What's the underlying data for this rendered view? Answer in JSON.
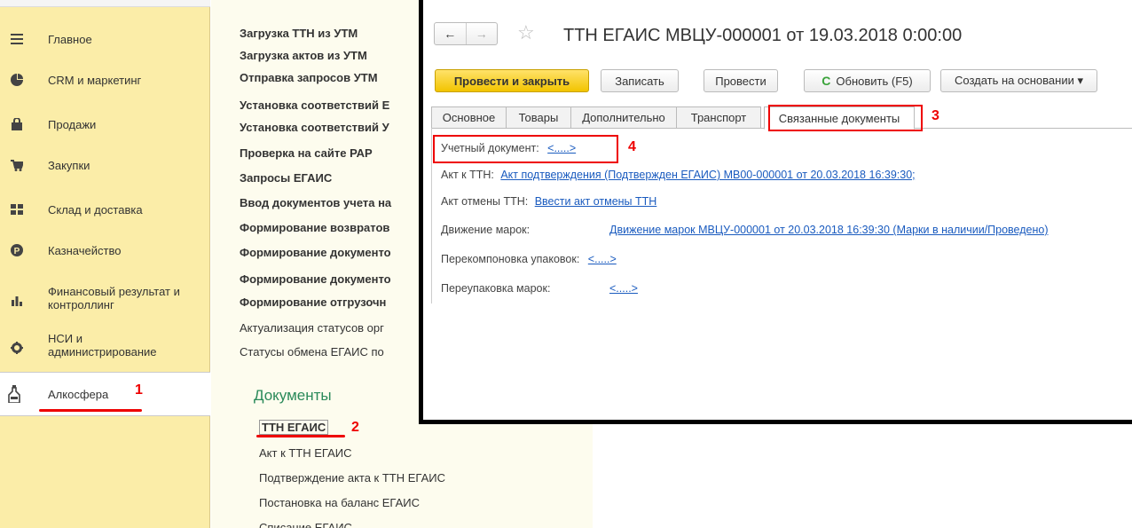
{
  "sidebar": {
    "items": [
      {
        "icon": "menu-icon",
        "label": "Главное"
      },
      {
        "icon": "pie-chart-icon",
        "label": "CRM и маркетинг"
      },
      {
        "icon": "bag-icon",
        "label": "Продажи"
      },
      {
        "icon": "cart-icon",
        "label": "Закупки"
      },
      {
        "icon": "warehouse-icon",
        "label": "Склад и доставка"
      },
      {
        "icon": "coin-icon",
        "label": "Казначейство"
      },
      {
        "icon": "bar-chart-icon",
        "label": "Финансовый результат и",
        "label2": "контроллинг"
      },
      {
        "icon": "gear-icon",
        "label": "НСИ и",
        "label2": "администрирование"
      },
      {
        "icon": "bottle-icon",
        "label": "Алкосфера"
      }
    ]
  },
  "middle": {
    "links": [
      "Загрузка ТТН из УТМ",
      "Загрузка актов из УТМ",
      "Отправка запросов УТМ",
      "Установка соответствий Е",
      "Установка соответствий У",
      "Проверка на сайте РАР",
      "Запросы ЕГАИС",
      "Ввод документов учета на",
      "Формирование возвратов",
      "Формирование документо",
      "Формирование документо",
      "Формирование отгрузочн"
    ],
    "plain_links": [
      "Актуализация статусов орг",
      "Статусы обмена ЕГАИС по"
    ],
    "section_title": "Документы",
    "documents": [
      "ТТН ЕГАИС",
      "Акт к ТТН ЕГАИС",
      "Подтверждение акта к ТТН ЕГАИС",
      "Постановка на баланс ЕГАИС",
      "Списание ЕГАИС"
    ]
  },
  "annotations": {
    "n1": "1",
    "n2": "2",
    "n3": "3",
    "n4": "4"
  },
  "window": {
    "nav_back": "←",
    "nav_forward": "→",
    "star": "☆",
    "title": "ТТН ЕГАИС МВЦУ-000001 от 19.03.2018 0:00:00",
    "toolbar": {
      "post_close": "Провести и закрыть",
      "save": "Записать",
      "post": "Провести",
      "refresh_icon": "C",
      "refresh": "Обновить (F5)",
      "create_based": "Создать на основании ▾"
    },
    "tabs": [
      "Основное",
      "Товары",
      "Дополнительно",
      "Транспорт",
      "Связанные документы"
    ],
    "rows": {
      "account_doc_label": "Учетный документ:",
      "account_doc_value": "<.....>",
      "act_label": "Акт к ТТН:",
      "act_value": "Акт подтверждения (Подтвержден ЕГАИС) МВ00-000001 от 20.03.2018 16:39:30;",
      "cancel_label": "Акт отмены ТТН:",
      "cancel_value": "Ввести акт отмены ТТН",
      "movement_label": "Движение марок:",
      "movement_value": "Движение марок МВЦУ-000001 от 20.03.2018 16:39:30 (Марки в наличии/Проведено)",
      "repack_label": "Перекомпоновка упаковок:",
      "repack_value": "<.....>",
      "remark_label": "Переупаковка марок:",
      "remark_value": "<.....>"
    }
  }
}
